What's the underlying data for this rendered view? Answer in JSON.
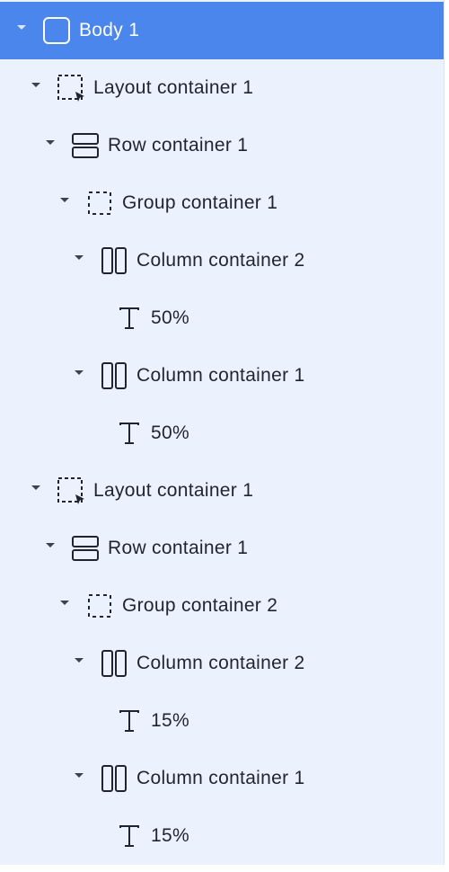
{
  "colors": {
    "panel_background": "#ecf2fd",
    "selected_background": "#4a86ec",
    "text": "#1f2430"
  },
  "tree": [
    {
      "label": "Body 1",
      "icon": "body-icon",
      "selected": true
    },
    {
      "label": "Layout container 1",
      "icon": "layout-container-icon"
    },
    {
      "label": "Row container 1",
      "icon": "row-container-icon"
    },
    {
      "label": "Group container 1",
      "icon": "group-container-icon"
    },
    {
      "label": "Column container 2",
      "icon": "column-container-icon"
    },
    {
      "label": "50%",
      "icon": "text-icon"
    },
    {
      "label": "Column container 1",
      "icon": "column-container-icon"
    },
    {
      "label": "50%",
      "icon": "text-icon"
    },
    {
      "label": "Layout container 1",
      "icon": "layout-container-icon"
    },
    {
      "label": "Row container 1",
      "icon": "row-container-icon"
    },
    {
      "label": "Group container 2",
      "icon": "group-container-icon"
    },
    {
      "label": "Column container 2",
      "icon": "column-container-icon"
    },
    {
      "label": "15%",
      "icon": "text-icon"
    },
    {
      "label": "Column container 1",
      "icon": "column-container-icon"
    },
    {
      "label": "15%",
      "icon": "text-icon"
    }
  ]
}
